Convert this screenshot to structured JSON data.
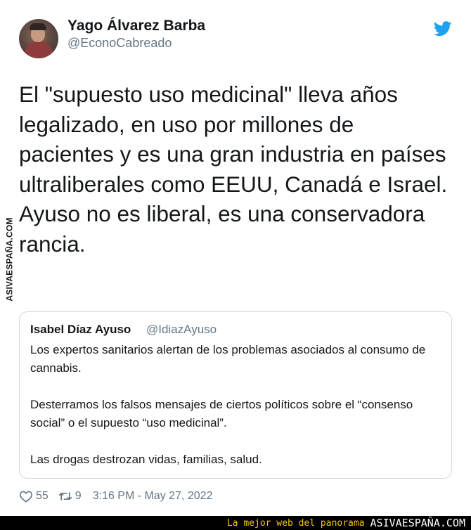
{
  "author": {
    "name": "Yago Álvarez Barba",
    "handle": "@EconoCabreado"
  },
  "tweet": {
    "text": "El \"supuesto uso medicinal\" lleva años legalizado, en uso por millones de pacientes y es una gran industria en países ultraliberales como EEUU, Canadá e Israel.\nAyuso no es liberal, es una conservadora rancia."
  },
  "quoted": {
    "name": "Isabel Díaz Ayuso",
    "handle": "@IdiazAyuso",
    "text": "Los expertos sanitarios alertan de los problemas asociados al consumo de cannabis.\n\nDesterramos los falsos mensajes de ciertos políticos sobre el “consenso social” o el supuesto “uso medicinal”.\n\nLas drogas destrozan vidas, familias, salud."
  },
  "stats": {
    "likes": "55",
    "retweets": "9",
    "timestamp": "3:16 PM - May 27, 2022"
  },
  "watermark": {
    "side": "ASIVAESPAÑA.COM",
    "footer_tagline": "La mejor web del panorama",
    "footer_brand": "ASIVAESPAÑA.COM"
  },
  "icons": {
    "platform": "twitter-bird-icon",
    "like": "heart-icon",
    "retweet": "retweet-icon"
  },
  "colors": {
    "twitter_blue": "#1da1f2",
    "secondary_text": "#657786",
    "footer_tagline": "#f5c518"
  }
}
